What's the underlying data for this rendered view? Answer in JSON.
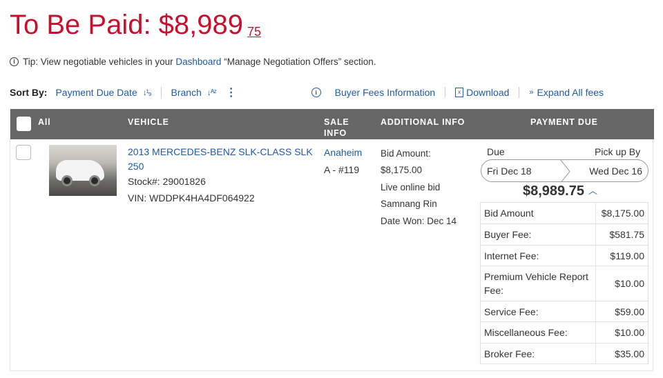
{
  "header": {
    "title": "To Be Paid: $8,989",
    "cents": "75"
  },
  "tip": {
    "prefix": "Tip: View negotiable vehicles in your",
    "link": "Dashboard",
    "suffix": "“Manage Negotiation Offers” section."
  },
  "toolbar": {
    "sort_by_label": "Sort By:",
    "sort_payment_due": "Payment Due Date",
    "sort_branch": "Branch",
    "buyer_fees": "Buyer Fees Information",
    "download": "Download",
    "expand": "Expand All fees"
  },
  "table": {
    "headers": {
      "all": "All",
      "vehicle": "VEHICLE",
      "sale_info_1": "SALE",
      "sale_info_2": "INFO",
      "additional": "ADDITIONAL INFO",
      "payment_due": "PAYMENT DUE"
    }
  },
  "row": {
    "vehicle": {
      "title": "2013 MERCEDES-BENZ SLK-CLASS SLK 250",
      "stock": "Stock#: 29001826",
      "vin": "VIN: WDDPK4HA4DF064922"
    },
    "sale": {
      "location": "Anaheim",
      "lot": "A - #119"
    },
    "additional": [
      "Bid Amount:",
      "$8,175.00",
      "Live online bid",
      "Samnang Rin",
      "Date Won: Dec 14"
    ],
    "payment": {
      "due_label": "Due",
      "pickup_label": "Pick up By",
      "due_date": "Fri Dec 18",
      "pickup_date": "Wed Dec 16",
      "total": "$8,989.75",
      "fees": [
        {
          "label": "Bid Amount",
          "value": "$8,175.00"
        },
        {
          "label": "Buyer Fee:",
          "value": "$581.75"
        },
        {
          "label": "Internet Fee:",
          "value": "$119.00"
        },
        {
          "label": "Premium Vehicle Report Fee:",
          "value": "$10.00"
        },
        {
          "label": "Service Fee:",
          "value": "$59.00"
        },
        {
          "label": "Miscellaneous Fee:",
          "value": "$10.00"
        },
        {
          "label": "Broker Fee:",
          "value": "$35.00"
        }
      ]
    }
  },
  "colors": {
    "title_red": "#c8102e",
    "link_blue": "#1f5aa8",
    "header_gray": "#666666"
  },
  "icons": [
    "info-circle-icon",
    "sort-numeric-icon",
    "sort-alpha-icon",
    "more-vertical-icon",
    "download-icon",
    "expand-chevrons-icon",
    "chevron-up-icon"
  ]
}
